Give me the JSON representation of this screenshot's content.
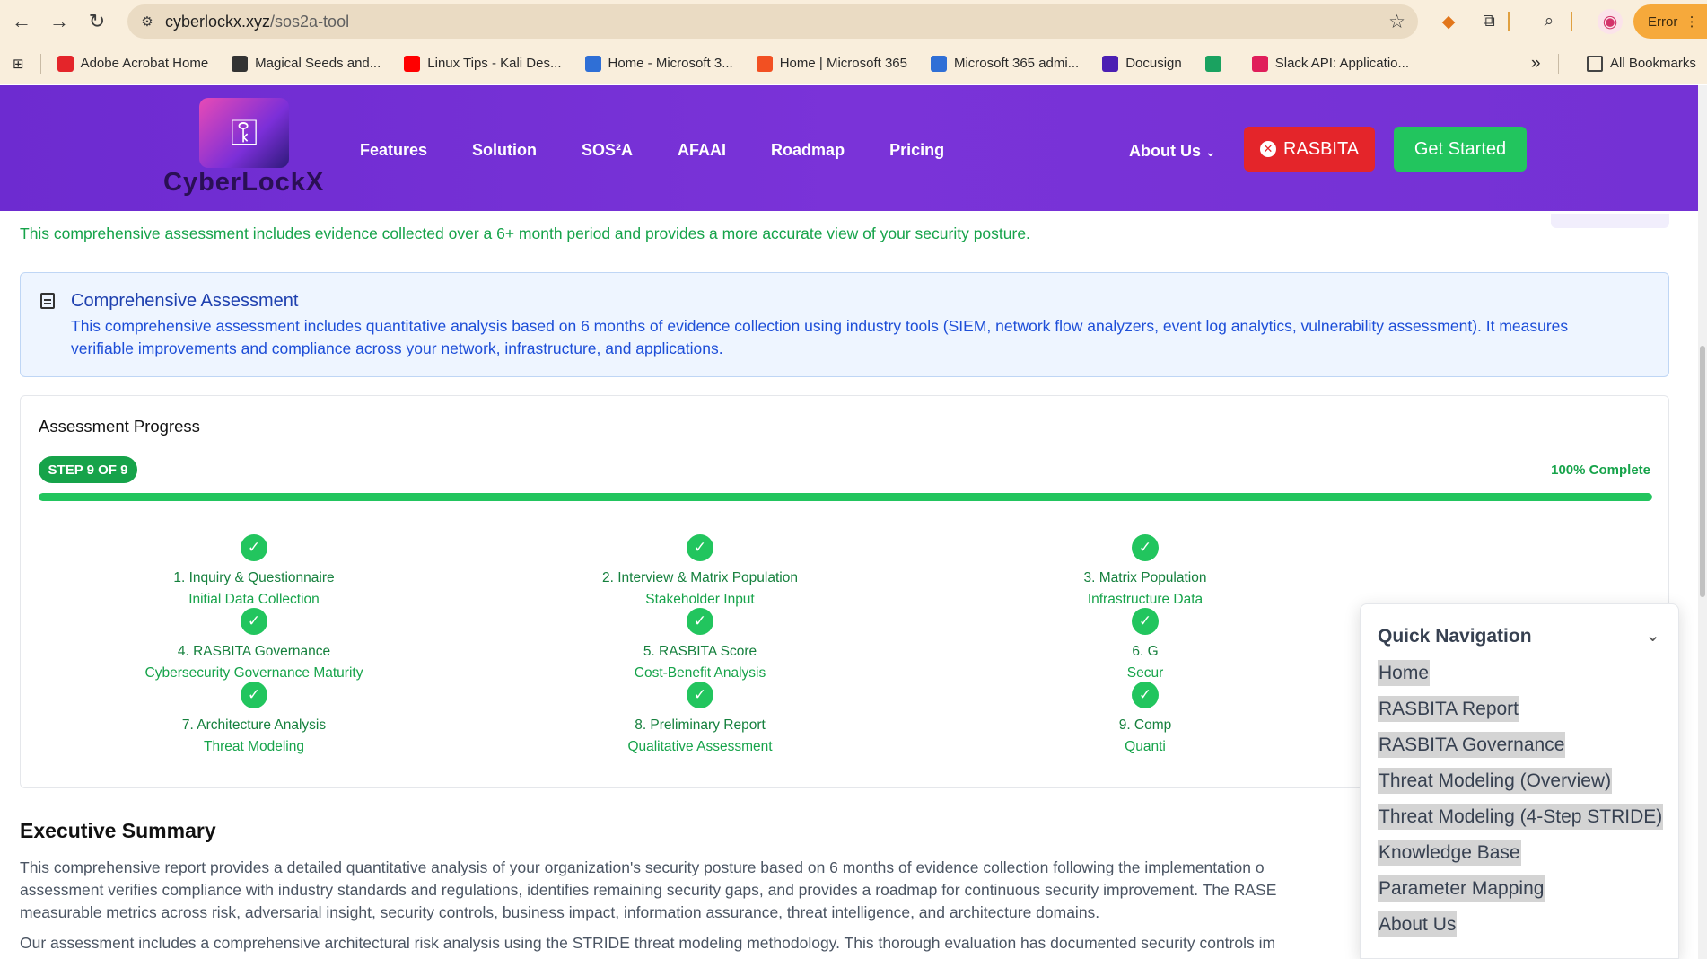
{
  "browser": {
    "url_host": "cyberlockx.xyz",
    "url_path": "/sos2a-tool",
    "profile_label": "Error",
    "bookmarks": [
      {
        "label": "Adobe Acrobat Home",
        "color": "#e4252a"
      },
      {
        "label": "Magical Seeds and...",
        "color": "#333333"
      },
      {
        "label": "Linux Tips - Kali Des...",
        "color": "#ff0000"
      },
      {
        "label": "Home - Microsoft 3...",
        "color": "#2f6fd6"
      },
      {
        "label": "Home | Microsoft 365",
        "color": "#f25022"
      },
      {
        "label": "Microsoft 365 admi...",
        "color": "#2f6fd6"
      },
      {
        "label": "Docusign",
        "color": "#4b1fb3"
      },
      {
        "label": "",
        "color": "#1aa260"
      },
      {
        "label": "Slack API: Applicatio...",
        "color": "#e01e5a"
      }
    ],
    "all_bookmarks_label": "All Bookmarks"
  },
  "site": {
    "logo_text": "CyberLockX",
    "nav": [
      "Features",
      "Solution",
      "SOS²A",
      "AFAAI",
      "Roadmap",
      "Pricing"
    ],
    "about_us": "About Us",
    "rasbita_button": "RASBITA",
    "get_started_button": "Get Started",
    "brand_color": "#7431d4"
  },
  "intro_text": "This comprehensive assessment includes evidence collected over a 6+ month period and provides a more accurate view of your security posture.",
  "info_box": {
    "title": "Comprehensive Assessment",
    "text": "This comprehensive assessment includes quantitative analysis based on 6 months of evidence collection using industry tools (SIEM, network flow analyzers, event log analytics, vulnerability assessment). It measures verifiable improvements and compliance across your network, infrastructure, and applications."
  },
  "progress": {
    "title": "Assessment Progress",
    "step_label": "STEP 9 OF 9",
    "complete_label": "100% Complete",
    "fraction_complete": 1.0,
    "steps": [
      {
        "name": "1. Inquiry & Questionnaire",
        "sub": "Initial Data Collection"
      },
      {
        "name": "2. Interview & Matrix Population",
        "sub": "Stakeholder Input"
      },
      {
        "name": "3. Matrix Population",
        "sub": "Infrastructure Data"
      },
      {
        "name": "4. RASBITA Governance",
        "sub": "Cybersecurity Governance Maturity"
      },
      {
        "name": "5. RASBITA Score",
        "sub": "Cost-Benefit Analysis"
      },
      {
        "name": "6. G",
        "sub": "Secur"
      },
      {
        "name": "7. Architecture Analysis",
        "sub": "Threat Modeling"
      },
      {
        "name": "8. Preliminary Report",
        "sub": "Qualitative Assessment"
      },
      {
        "name": "9. Comp",
        "sub": "Quanti"
      }
    ]
  },
  "executive_summary": {
    "title": "Executive Summary",
    "p1_line1": "This comprehensive report provides a detailed quantitative analysis of your organization's security posture based on 6 months of evidence collection following the implementation o",
    "p1_line2": "assessment verifies compliance with industry standards and regulations, identifies remaining security gaps, and provides a roadmap for continuous security improvement. The RASE",
    "p1_line3": "measurable metrics across risk, adversarial insight, security controls, business impact, information assurance, threat intelligence, and architecture domains.",
    "p2": "Our assessment includes a comprehensive architectural risk analysis using the STRIDE threat modeling methodology. This thorough evaluation has documented security controls im"
  },
  "quick_nav": {
    "title": "Quick Navigation",
    "items": [
      "Home",
      "RASBITA Report",
      "RASBITA Governance",
      "Threat Modeling (Overview)",
      "Threat Modeling (4-Step STRIDE)",
      "Knowledge Base",
      "Parameter Mapping",
      "About Us"
    ]
  }
}
